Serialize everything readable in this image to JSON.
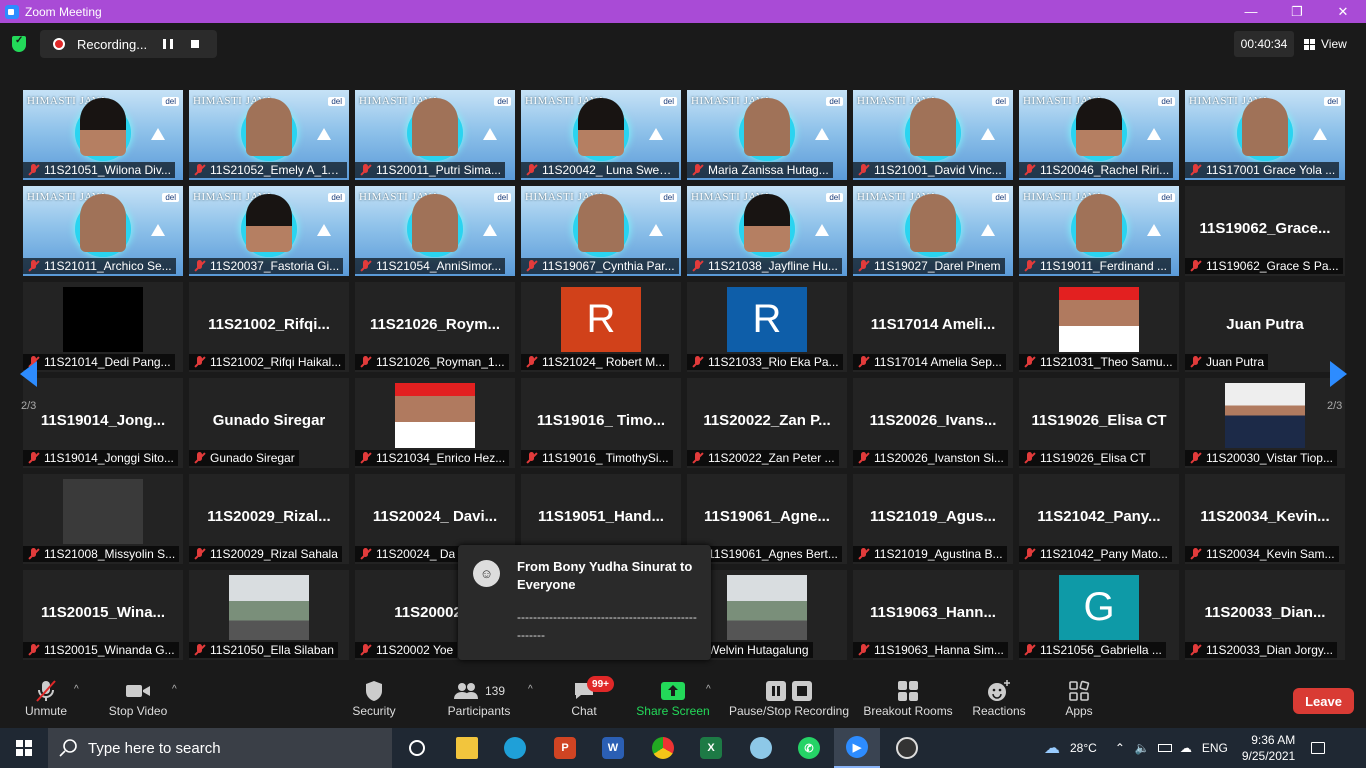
{
  "titlebar": {
    "title": "Zoom Meeting",
    "min": "—",
    "restore": "❐",
    "close": "✕"
  },
  "recording": {
    "label": "Recording..."
  },
  "timer": "00:40:34",
  "view_label": "View",
  "page_left": "2/3",
  "page_right": "2/3",
  "video_banner": {
    "title": "HIMASTI JAYA",
    "logo": "del"
  },
  "tiles": [
    {
      "caption": "11S21051_Wilona Div...",
      "kind": "video"
    },
    {
      "caption": "11S21052_Emely A_11...",
      "kind": "video"
    },
    {
      "caption": "11S20011_Putri Sima...",
      "kind": "video"
    },
    {
      "caption": "11S20042_ Luna Swee...",
      "kind": "video"
    },
    {
      "caption": "Maria Zanissa Hutag...",
      "kind": "video"
    },
    {
      "caption": "11S21001_David Vinc...",
      "kind": "video"
    },
    {
      "caption": "11S20046_Rachel Riri...",
      "kind": "video"
    },
    {
      "caption": "11S17001 Grace Yola ...",
      "kind": "video"
    },
    {
      "caption": "11S21011_Archico Se...",
      "kind": "video"
    },
    {
      "caption": "11S20037_Fastoria Gi...",
      "kind": "video"
    },
    {
      "caption": "11S21054_AnniSimor...",
      "kind": "video"
    },
    {
      "caption": "11S19067_Cynthia Par...",
      "kind": "video"
    },
    {
      "caption": "11S21038_Jayfline Hu...",
      "kind": "video"
    },
    {
      "caption": "11S19027_Darel Pinem",
      "kind": "video"
    },
    {
      "caption": "11S19011_Ferdinand ...",
      "kind": "video"
    },
    {
      "caption": "11S19062_Grace S Pa...",
      "kind": "name",
      "big": "11S19062_Grace..."
    },
    {
      "caption": "11S21014_Dedi Pang...",
      "kind": "black"
    },
    {
      "caption": "11S21002_Rifqi Haikal...",
      "kind": "name",
      "big": "11S21002_Rifqi..."
    },
    {
      "caption": "11S21026_Royman_1...",
      "kind": "name",
      "big": "11S21026_Roym..."
    },
    {
      "caption": "11S21024_ Robert M...",
      "kind": "letter",
      "letter": "R",
      "color": "#d1411a"
    },
    {
      "caption": "11S21033_Rio Eka Pa...",
      "kind": "letter",
      "letter": "R",
      "color": "#0e5ea9"
    },
    {
      "caption": "11S17014 Amelia Sep...",
      "kind": "name",
      "big": "11S17014 Ameli..."
    },
    {
      "caption": "11S21031_Theo Samu...",
      "kind": "photo-red"
    },
    {
      "caption": "Juan Putra",
      "kind": "name",
      "big": "Juan Putra"
    },
    {
      "caption": "11S19014_Jonggi Sito...",
      "kind": "name",
      "big": "11S19014_Jong..."
    },
    {
      "caption": "Gunado Siregar",
      "kind": "name",
      "big": "Gunado Siregar"
    },
    {
      "caption": "11S21034_Enrico Hez...",
      "kind": "photo-red"
    },
    {
      "caption": "11S19016_ TimothySi...",
      "kind": "name",
      "big": "11S19016_ Timo..."
    },
    {
      "caption": "11S20022_Zan Peter ...",
      "kind": "name",
      "big": "11S20022_Zan P..."
    },
    {
      "caption": "11S20026_Ivanston Si...",
      "kind": "name",
      "big": "11S20026_Ivans..."
    },
    {
      "caption": "11S19026_Elisa CT",
      "kind": "name",
      "big": "11S19026_Elisa CT"
    },
    {
      "caption": "11S20030_Vistar Tiop...",
      "kind": "photo-white"
    },
    {
      "caption": "11S21008_Missyolin S...",
      "kind": "grey"
    },
    {
      "caption": "11S20029_Rizal Sahala",
      "kind": "name",
      "big": "11S20029_Rizal..."
    },
    {
      "caption": "11S20024_ Da",
      "kind": "name",
      "big": "11S20024_ Davi..."
    },
    {
      "caption": "",
      "kind": "name",
      "big": "11S19051_Hand..."
    },
    {
      "caption": "11S19061_Agnes Bert...",
      "kind": "name",
      "big": "11S19061_Agne..."
    },
    {
      "caption": "11S21019_Agustina B...",
      "kind": "name",
      "big": "11S21019_Agus..."
    },
    {
      "caption": "11S21042_Pany Mato...",
      "kind": "name",
      "big": "11S21042_Pany..."
    },
    {
      "caption": "11S20034_Kevin Sam...",
      "kind": "name",
      "big": "11S20034_Kevin..."
    },
    {
      "caption": "11S20015_Winanda G...",
      "kind": "name",
      "big": "11S20015_Wina..."
    },
    {
      "caption": "11S21050_Ella Silaban",
      "kind": "photo-outdoor"
    },
    {
      "caption": "11S20002 Yoe",
      "kind": "name",
      "big": "11S20002 Y"
    },
    {
      "caption": "",
      "kind": "name",
      "big": ""
    },
    {
      "caption": "Welvin Hutagalung",
      "kind": "photo-outdoor"
    },
    {
      "caption": "11S19063_Hanna Sim...",
      "kind": "name",
      "big": "11S19063_Hann..."
    },
    {
      "caption": "11S21056_Gabriella ...",
      "kind": "letter",
      "letter": "G",
      "color": "#0e9aa7"
    },
    {
      "caption": "11S20033_Dian Jorgy...",
      "kind": "name",
      "big": "11S20033_Dian..."
    }
  ],
  "chat_popup": {
    "from": "From Bony Yudha Sinurat to Everyone",
    "message": "----------------------------------------------------",
    "avatar": "☺"
  },
  "toolbar": {
    "unmute": "Unmute",
    "stop_video": "Stop Video",
    "security": "Security",
    "participants": "Participants",
    "participants_count": "139",
    "chat": "Chat",
    "chat_badge": "99+",
    "share_screen": "Share Screen",
    "pause_recording": "Pause/Stop Recording",
    "breakout": "Breakout Rooms",
    "reactions": "Reactions",
    "apps": "Apps",
    "leave": "Leave"
  },
  "taskbar": {
    "search_placeholder": "Type here to search",
    "temp": "28°C",
    "lang": "ENG",
    "time": "9:36 AM",
    "date": "9/25/2021"
  },
  "colors": {
    "accent": "#a94bd6",
    "zoom_blue": "#2d8cff",
    "leave_red": "#d93b34",
    "share_green": "#23d959"
  }
}
